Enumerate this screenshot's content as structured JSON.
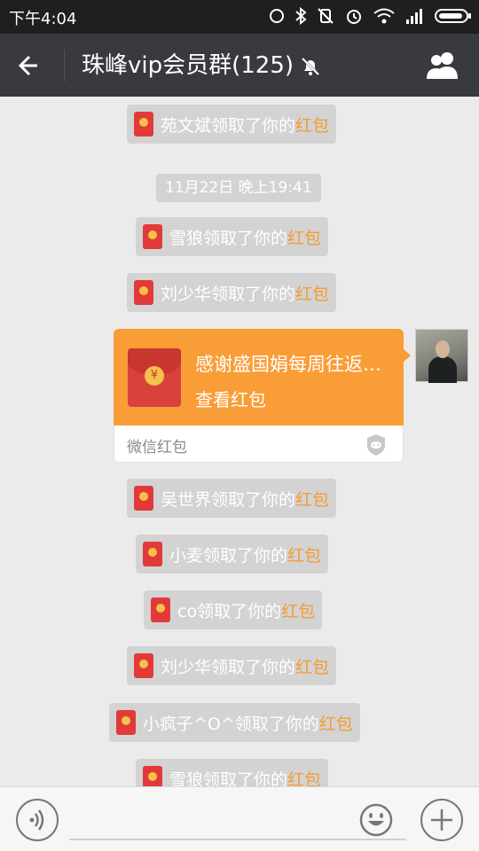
{
  "status_bar": {
    "time": "下午4:04",
    "icons": [
      "sync-icon",
      "bluetooth-icon",
      "vibrate-off-icon",
      "alarm-icon",
      "wifi-icon",
      "signal-icon",
      "battery-icon"
    ]
  },
  "header": {
    "title": "珠峰vip会员群(125)",
    "muted": true
  },
  "messages": {
    "sys1": {
      "name": "苑文斌领取了你的",
      "link": "红包"
    },
    "timestamp": "11月22日 晚上19:41",
    "sys2": {
      "name": "雪狼领取了你的",
      "link": "红包"
    },
    "sys3": {
      "name": "刘少华领取了你的",
      "link": "红包"
    },
    "packet": {
      "message": "感谢盛国娟每周往返…",
      "action": "查看红包",
      "footer": "微信红包",
      "coin_symbol": "¥"
    },
    "sys4": {
      "name": "吴世界领取了你的",
      "link": "红包"
    },
    "sys5": {
      "name": "小麦领取了你的",
      "link": "红包"
    },
    "sys6": {
      "name": "co领取了你的",
      "link": "红包"
    },
    "sys7": {
      "name": "刘少华领取了你的",
      "link": "红包"
    },
    "sys8": {
      "name": "小疯子^O^领取了你的",
      "link": "红包"
    },
    "sys9": {
      "name": "雪狼领取了你的",
      "link": "红包"
    }
  },
  "colors": {
    "header_bg": "#393a3f",
    "packet_orange": "#f99d37",
    "link_orange": "#f59b33",
    "sys_bg": "#d3d3d3"
  }
}
